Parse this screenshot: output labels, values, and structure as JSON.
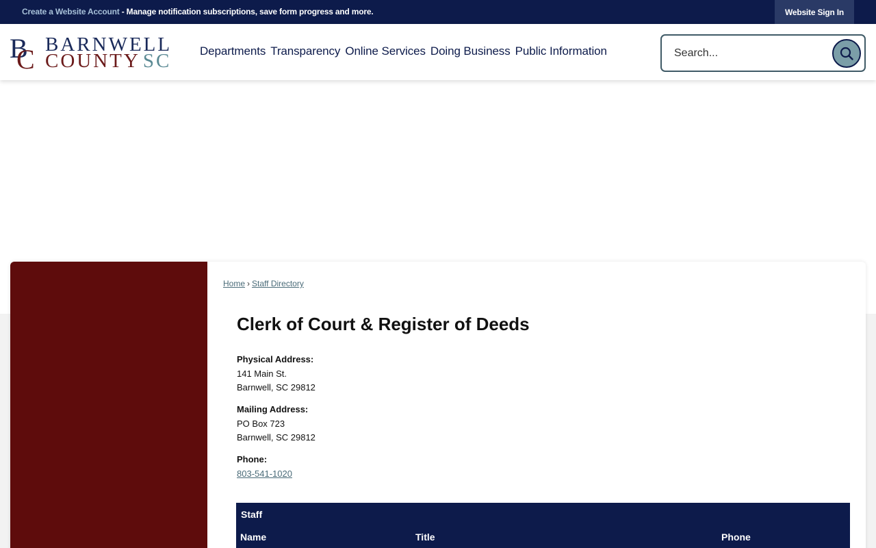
{
  "topbar": {
    "create_account_link": "Create a Website Account",
    "message": " - Manage notification subscriptions, save form progress and more.",
    "sign_in": "Website Sign In"
  },
  "logo": {
    "mono_b": "B",
    "mono_c": "C",
    "line1": "BARNWELL",
    "line2": "COUNTY",
    "sc": "SC"
  },
  "nav": {
    "items": [
      "Departments",
      "Transparency",
      "Online Services",
      "Doing Business",
      "Public Information"
    ]
  },
  "search": {
    "placeholder": "Search..."
  },
  "breadcrumb": {
    "home": "Home",
    "separator": "›",
    "current": "Staff Directory"
  },
  "department": {
    "title": "Clerk of Court & Register of Deeds",
    "physical_label": "Physical Address:",
    "physical_line1": "141 Main St.",
    "physical_line2": "Barnwell, SC 29812",
    "mailing_label": "Mailing Address:",
    "mailing_line1": "PO Box 723",
    "mailing_line2": "Barnwell, SC 29812",
    "phone_label": "Phone:",
    "phone": "803-541-1020"
  },
  "staff_table": {
    "caption": "Staff",
    "columns": [
      "Name",
      "Title",
      "Phone"
    ]
  },
  "colors": {
    "navy": "#0d1b4b",
    "maroon": "#5e0c0c",
    "teal": "#5b8a94"
  }
}
